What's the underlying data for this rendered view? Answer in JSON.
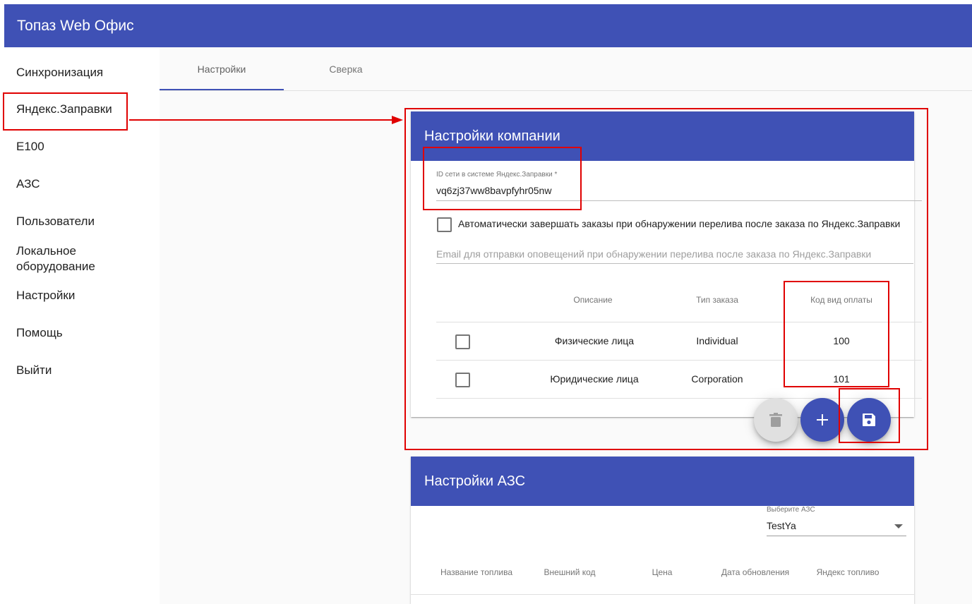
{
  "app": {
    "title": "Топаз Web Офис"
  },
  "sidebar": {
    "items": [
      {
        "label": "Синхронизация"
      },
      {
        "label": "Яндекс.Заправки"
      },
      {
        "label": "E100"
      },
      {
        "label": "АЗС"
      },
      {
        "label": "Пользователи"
      },
      {
        "label": "Локальное оборудование"
      },
      {
        "label": "Настройки"
      },
      {
        "label": "Помощь"
      },
      {
        "label": "Выйти"
      }
    ]
  },
  "tabs": [
    {
      "label": "Настройки",
      "active": true
    },
    {
      "label": "Сверка",
      "active": false
    }
  ],
  "company_settings": {
    "title": "Настройки компании",
    "network_id": {
      "label": "ID сети в системе Яндекс.Заправки *",
      "value": "vq6zj37ww8bavpfyhr05nw"
    },
    "auto_complete": {
      "label": "Автоматически завершать заказы при обнаружении перелива после заказа по Яндекс.Заправки",
      "checked": false
    },
    "email": {
      "placeholder": "Email для отправки оповещений при обнаружении перелива после заказа по Яндекс.Заправки",
      "value": ""
    },
    "table": {
      "headers": [
        "Описание",
        "Тип заказа",
        "Код вид оплаты"
      ],
      "rows": [
        {
          "description": "Физические лица",
          "order_type": "Individual",
          "payment_code": "100"
        },
        {
          "description": "Юридические лица",
          "order_type": "Corporation",
          "payment_code": "101"
        }
      ]
    }
  },
  "station_settings": {
    "title": "Настройки АЗС",
    "select": {
      "label": "Выберите АЗС",
      "value": "TestYa"
    },
    "table": {
      "headers": [
        "Название топлива",
        "Внешний код",
        "Цена",
        "Дата обновления",
        "Яндекс топливо"
      ]
    }
  },
  "colors": {
    "primary": "#3f51b5",
    "annotation": "#e00000",
    "fab_disabled": "#e0e0e0"
  }
}
